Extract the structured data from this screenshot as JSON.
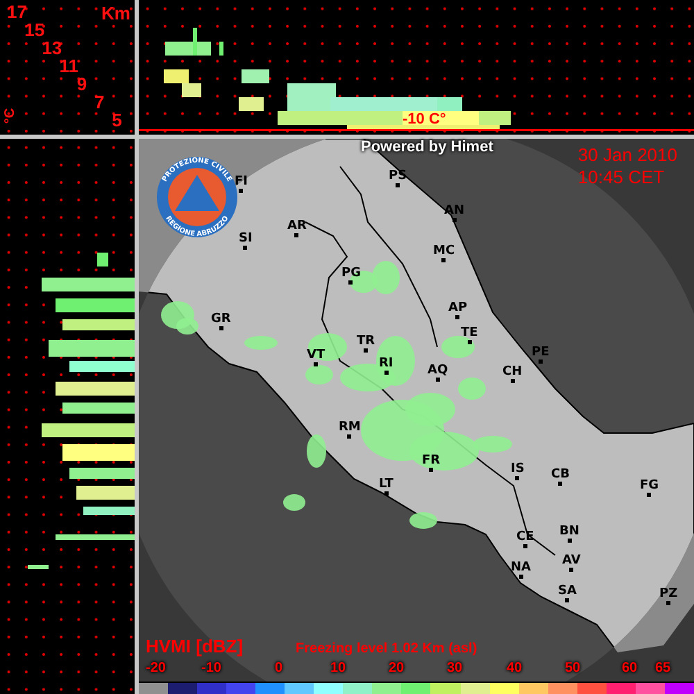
{
  "altitude_scale": {
    "unit": "Km",
    "labels": [
      "17",
      "15",
      "13",
      "11",
      "9",
      "7",
      "5"
    ],
    "temperature_unit": "°C"
  },
  "vertical_section": {
    "isotherm_label": "-10 C°"
  },
  "map": {
    "credit": "Powered by Himet",
    "date": "30 Jan 2010",
    "time": "10:45 CET",
    "logo": {
      "top_text": "PROTEZIONE CIVILE",
      "bottom_text": "REGIONE ABRUZZO"
    },
    "cities": [
      {
        "label": "FI"
      },
      {
        "label": "PS"
      },
      {
        "label": "AN"
      },
      {
        "label": "AR"
      },
      {
        "label": "SI"
      },
      {
        "label": "MC"
      },
      {
        "label": "PG"
      },
      {
        "label": "AP"
      },
      {
        "label": "GR"
      },
      {
        "label": "TE"
      },
      {
        "label": "TR"
      },
      {
        "label": "VT"
      },
      {
        "label": "PE"
      },
      {
        "label": "RI"
      },
      {
        "label": "CH"
      },
      {
        "label": "AQ"
      },
      {
        "label": "RM"
      },
      {
        "label": "IS"
      },
      {
        "label": "CB"
      },
      {
        "label": "FR"
      },
      {
        "label": "FG"
      },
      {
        "label": "LT"
      },
      {
        "label": "CE"
      },
      {
        "label": "BN"
      },
      {
        "label": "AV"
      },
      {
        "label": "NA"
      },
      {
        "label": "SA"
      },
      {
        "label": "PZ"
      }
    ]
  },
  "legend": {
    "title": "HVMI [dBZ]",
    "freezing_level": "Freezing level  1.02 Km (asl)",
    "ticks": [
      "-20",
      "-10",
      "0",
      "10",
      "20",
      "30",
      "40",
      "50",
      "60",
      "65"
    ],
    "colors": [
      {
        "color": "#909090"
      },
      {
        "color": "#1c1c70"
      },
      {
        "color": "#3030c8"
      },
      {
        "color": "#4444ee"
      },
      {
        "color": "#2090ff"
      },
      {
        "color": "#60c8ff"
      },
      {
        "color": "#90ffff"
      },
      {
        "color": "#90f0c8"
      },
      {
        "color": "#90f090"
      },
      {
        "color": "#70f070"
      },
      {
        "color": "#c0f060"
      },
      {
        "color": "#e0f090"
      },
      {
        "color": "#ffff60"
      },
      {
        "color": "#ffc860"
      },
      {
        "color": "#ff9060"
      },
      {
        "color": "#ff5040"
      },
      {
        "color": "#ff2070"
      },
      {
        "color": "#ff50a0"
      },
      {
        "color": "#c000ff"
      }
    ]
  }
}
